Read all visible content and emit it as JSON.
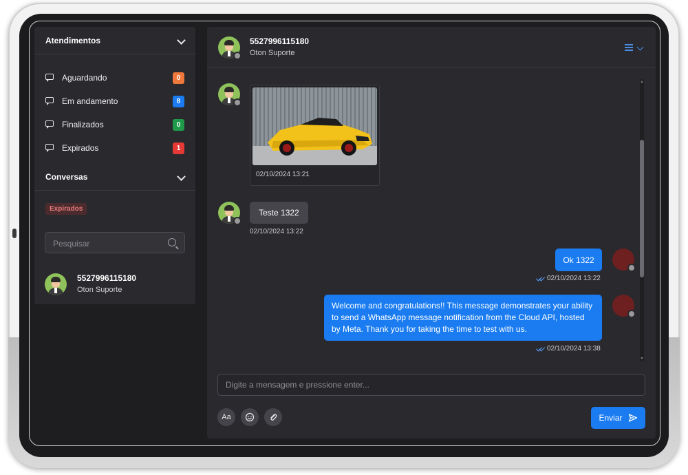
{
  "sidebar": {
    "atendimentos": {
      "title": "Atendimentos",
      "items": [
        {
          "label": "Aguardando",
          "count": "0",
          "color": "#f0783c"
        },
        {
          "label": "Em andamento",
          "count": "8",
          "color": "#1a7cf0"
        },
        {
          "label": "Finalizados",
          "count": "0",
          "color": "#1f9a4a"
        },
        {
          "label": "Expirados",
          "count": "1",
          "color": "#e53935"
        }
      ]
    },
    "conversas": {
      "title": "Conversas",
      "filter_tag": "Expirados",
      "search_placeholder": "Pesquisar",
      "contacts": [
        {
          "name": "5527996115180",
          "subtitle": "Oton Suporte"
        }
      ]
    }
  },
  "chat": {
    "header": {
      "name": "5527996115180",
      "subtitle": "Oton Suporte"
    },
    "messages": [
      {
        "direction": "in",
        "type": "image",
        "time": "02/10/2024 13:21"
      },
      {
        "direction": "in",
        "type": "text",
        "text": "Teste 1322",
        "time": "02/10/2024 13:22"
      },
      {
        "direction": "out",
        "type": "text",
        "text": "Ok 1322",
        "time": "02/10/2024 13:22"
      },
      {
        "direction": "out",
        "type": "text",
        "text": "Welcome and congratulations!! This message demonstrates your ability to send a WhatsApp message notification from the Cloud API, hosted by Meta. Thank you for taking the time to test with us.",
        "time": "02/10/2024 13:38"
      }
    ],
    "composer": {
      "placeholder": "Digite a mensagem e pressione enter...",
      "send_label": "Enviar",
      "format_label": "Aa"
    }
  }
}
